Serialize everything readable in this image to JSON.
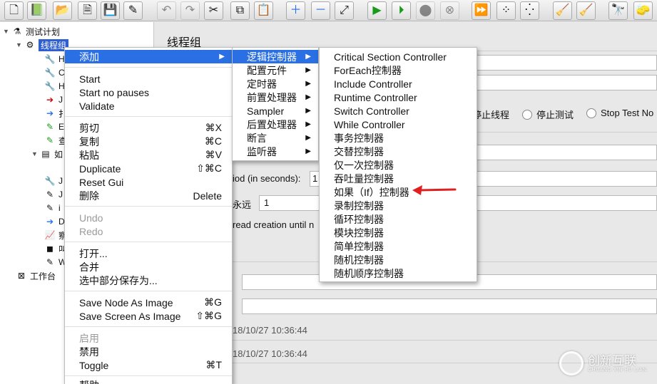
{
  "toolbar": {
    "icons": [
      "new-icon",
      "templates-icon",
      "open-icon",
      "close-icon",
      "save-icon",
      "save-as-icon",
      "undo-icon",
      "redo-icon",
      "cut-icon",
      "copy-icon",
      "paste-icon",
      "expand-icon",
      "collapse-icon",
      "toggle-icon",
      "start-icon",
      "start-no-pauses-icon",
      "stop-icon",
      "shutdown-icon",
      "remote-start-icon",
      "remote-stop-icon",
      "remote-exit-icon",
      "clear-icon",
      "clear-all-icon",
      "search-icon",
      "reset-search-icon"
    ]
  },
  "tree": {
    "test_plan": "测试计划",
    "thread_group": "线程组",
    "workbench": "工作台",
    "child_glyphs": [
      "H",
      "C",
      "H",
      "J",
      "扌",
      "E",
      "查",
      "如",
      "J",
      "J",
      "i",
      "D",
      "察",
      "叫",
      "W"
    ]
  },
  "right": {
    "title": "线程组",
    "radios": [
      "停止线程",
      "停止测试",
      "Stop Test No"
    ],
    "rampup_label": "iod (in seconds):",
    "rampup_value": "1",
    "loop_label": "永远",
    "loop_value": "1",
    "delay_label": "read creation until n",
    "start_time": "18/10/27 10:36:44",
    "end_time": "18/10/27 10:36:44"
  },
  "context_menu": {
    "add": "添加",
    "start": "Start",
    "start_no_pauses": "Start no pauses",
    "validate": "Validate",
    "cut": "剪切",
    "cut_sc": "⌘X",
    "copy": "复制",
    "copy_sc": "⌘C",
    "paste": "粘贴",
    "paste_sc": "⌘V",
    "duplicate": "Duplicate",
    "duplicate_sc": "⇧⌘C",
    "reset_gui": "Reset Gui",
    "delete": "删除",
    "delete_sc": "Delete",
    "undo": "Undo",
    "redo": "Redo",
    "open": "打开...",
    "merge": "合并",
    "save_selection": "选中部分保存为...",
    "save_node_image": "Save Node As Image",
    "save_node_image_sc": "⌘G",
    "save_screen_image": "Save Screen As Image",
    "save_screen_image_sc": "⇧⌘G",
    "enable": "启用",
    "disable": "禁用",
    "toggle": "Toggle",
    "toggle_sc": "⌘T",
    "help_partial": "帮助"
  },
  "add_menu": {
    "items": [
      "逻辑控制器",
      "配置元件",
      "定时器",
      "前置处理器",
      "Sampler",
      "后置处理器",
      "断言",
      "监听器"
    ]
  },
  "logic_menu": {
    "items": [
      "Critical Section Controller",
      "ForEach控制器",
      "Include Controller",
      "Runtime Controller",
      "Switch Controller",
      "While Controller",
      "事务控制器",
      "交替控制器",
      "仅一次控制器",
      "吞吐量控制器",
      "如果（If）控制器",
      "录制控制器",
      "循环控制器",
      "模块控制器",
      "简单控制器",
      "随机控制器",
      "随机顺序控制器"
    ]
  },
  "colors": {
    "highlight": "#2a6fe3",
    "selection": "#2f5fcf",
    "arrow": "#e02020"
  },
  "watermark": {
    "text": "创新互联",
    "sub": "CHUANG XIN HU LIAN"
  }
}
